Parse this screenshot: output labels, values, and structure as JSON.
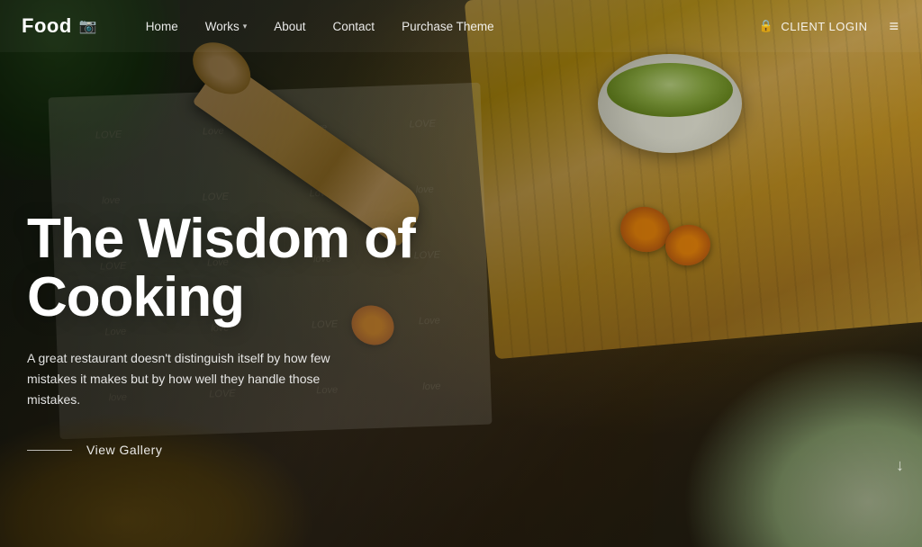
{
  "site": {
    "logo_text": "Food",
    "logo_icon": "📷"
  },
  "nav": {
    "links": [
      {
        "label": "Home",
        "has_dropdown": false
      },
      {
        "label": "Works",
        "has_dropdown": true
      },
      {
        "label": "About",
        "has_dropdown": false
      },
      {
        "label": "Contact",
        "has_dropdown": false
      },
      {
        "label": "Purchase Theme",
        "has_dropdown": false
      }
    ],
    "client_login_label": "CLIENT LOGIN",
    "menu_icon": "≡"
  },
  "hero": {
    "title": "The Wisdom of Cooking",
    "subtitle": "A great restaurant doesn't distinguish itself by how few mistakes it makes but by how well they handle those mistakes.",
    "cta_label": "View Gallery",
    "scroll_icon": "↓"
  },
  "textile_words": [
    "LOVE",
    "Love",
    "love",
    "LOVE",
    "Love",
    "love",
    "LOVE",
    "Love",
    "love",
    "LOVE",
    "Love",
    "love",
    "LOVE",
    "Love",
    "love",
    "LOVE",
    "Love",
    "love",
    "LOVE",
    "Love"
  ]
}
